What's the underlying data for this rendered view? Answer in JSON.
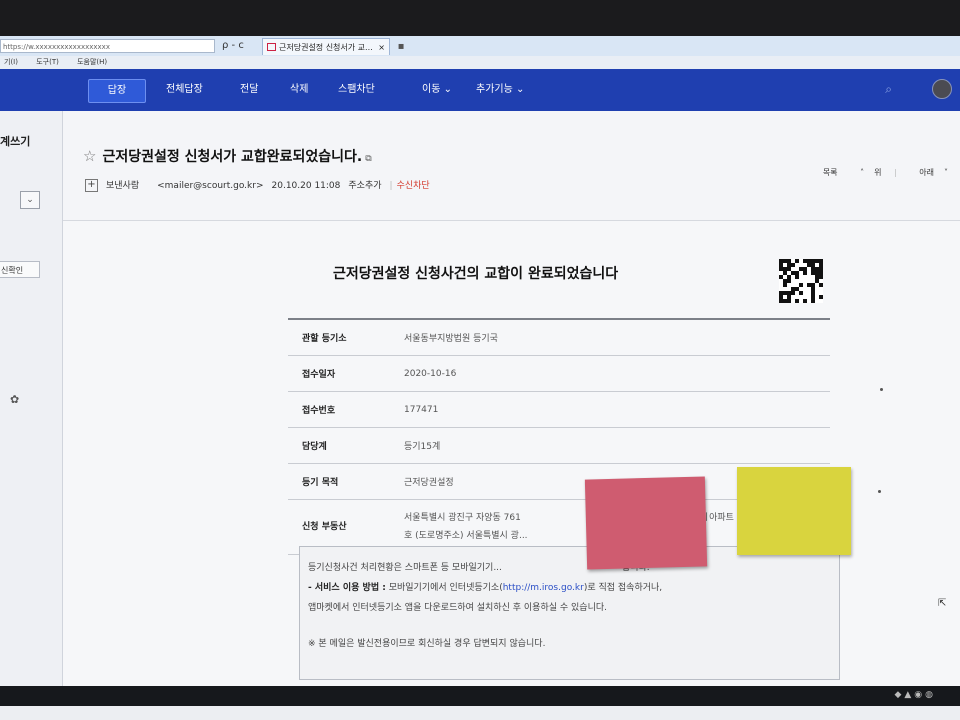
{
  "browser": {
    "address_text": "https://w.xxxxxxxxxxxxxxxxxx",
    "controls": "ρ - c",
    "tab_title": "근저당권설정 신청서가 교...",
    "tab_close": "×",
    "menu": [
      "기(I)",
      "도구(T)",
      "도움말(H)"
    ]
  },
  "nav": {
    "reply": "답장",
    "reply_all": "전체답장",
    "forward": "전달",
    "delete": "삭제",
    "spam_block": "스팸차단",
    "move": "이동",
    "more": "추가기능"
  },
  "sidebar": {
    "write": "계쓰기",
    "confirm": "신확인"
  },
  "mail": {
    "subject": "근저당권설정 신청서가 교합완료되었습니다.",
    "sender_label": "보낸사람",
    "sender_email": "<mailer@scourt.go.kr>",
    "datetime": "20.10.20 11:08",
    "add_address": "주소추가",
    "block_receive": "수신차단",
    "list_btn": "목록",
    "up_btn": "위",
    "down_btn": "아래"
  },
  "body": {
    "title": "근저당권설정 신청사건의 교합이 완료되었습니다",
    "rows": [
      {
        "label": "관할 등기소",
        "value": "서울동부지방법원 등기국"
      },
      {
        "label": "접수일자",
        "value": "2020-10-16"
      },
      {
        "label": "접수번호",
        "value": "177471"
      },
      {
        "label": "담당계",
        "value": "등기15계"
      },
      {
        "label": "등기 목적",
        "value": "근저당권설정"
      },
      {
        "label": "신청 부동산",
        "value": "서울특별시 광진구 자양동 761",
        "value2": "호 (도로명주소) 서울특별시 광...",
        "value_right": "ㅔ아파트"
      }
    ],
    "notice_line1": "등기신청사건 처리현황은 스마트폰 등 모바일기기...",
    "notice_line1_end": "합니다.",
    "notice_method_label": "- 서비스 이용 방법 :",
    "notice_method_text": "모바일기기에서 인터넷등기소(",
    "notice_link": "http://m.iros.go.kr",
    "notice_method_end": ")로 직접 접속하거나,",
    "notice_line3": "앱마켓에서 인터넷등기소 앱을 다운로드하여 설치하신 후 이용하실 수 있습니다.",
    "notice_warning": "※ 본 메일은 발신전용이므로 회신하실 경우 답변되지 않습니다."
  },
  "colors": {
    "nav_blue": "#1f3fb0",
    "sticky_pink": "#cf5c70",
    "sticky_yellow": "#d9d43e",
    "block_red": "#d33b2e"
  }
}
